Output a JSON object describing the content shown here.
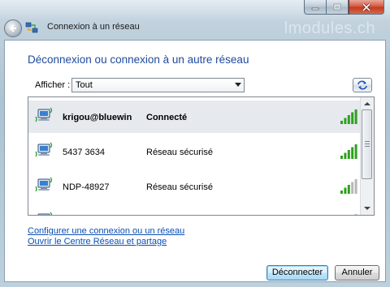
{
  "window": {
    "title": "Connexion à un réseau",
    "watermark": "lmodules.ch"
  },
  "heading": "Déconnexion ou connexion à un autre réseau",
  "filter": {
    "label": "Afficher :",
    "selected": "Tout"
  },
  "networks": [
    {
      "name": "krigou@bluewin",
      "status": "Connecté",
      "signal_bars": 5,
      "selected": true
    },
    {
      "name": "5437 3634",
      "status": "Réseau sécurisé",
      "signal_bars": 5,
      "selected": false
    },
    {
      "name": "NDP-48927",
      "status": "Réseau sécurisé",
      "signal_bars": 3,
      "selected": false
    },
    {
      "name": "",
      "status": "",
      "signal_bars": 1,
      "selected": false
    }
  ],
  "links": {
    "configure": "Configurer une connexion ou un réseau",
    "open_center": "Ouvrir le Centre Réseau et partage"
  },
  "buttons": {
    "disconnect": "Déconnecter",
    "cancel": "Annuler"
  },
  "colors": {
    "heading": "#1f4a9a",
    "link": "#0a4fb5",
    "signal_on": "#2ea01e",
    "signal_off": "#b8b8b8"
  },
  "icons": {
    "back": "back-arrow-icon",
    "app": "network-connection-icon",
    "refresh": "refresh-icon",
    "network": "wireless-network-icon",
    "signal": "signal-strength-icon"
  }
}
